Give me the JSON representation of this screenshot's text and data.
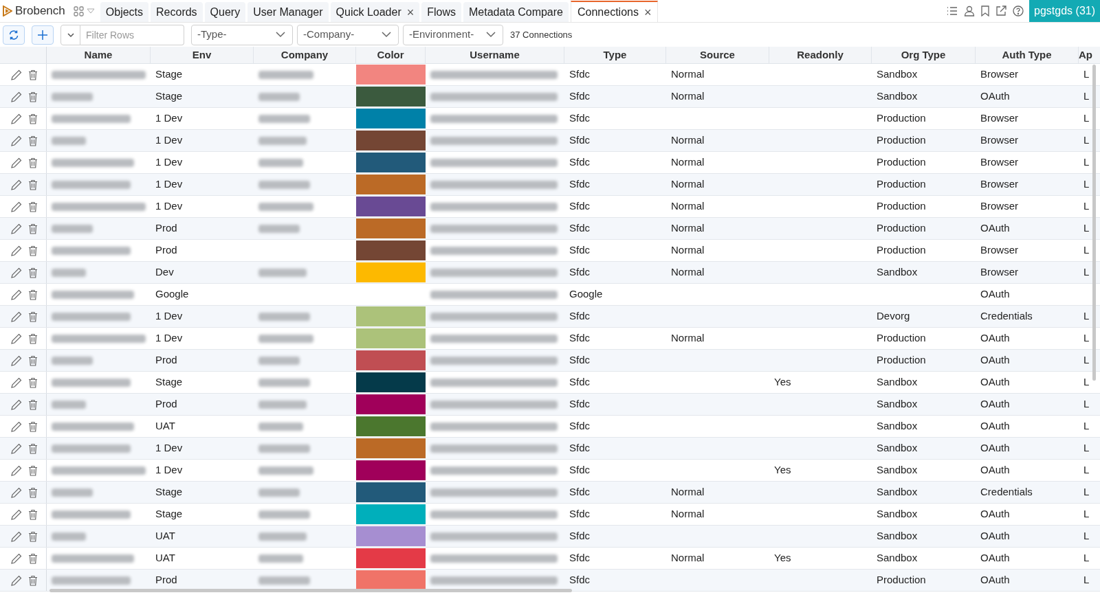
{
  "app": {
    "name": "Brobench"
  },
  "tabs": [
    {
      "label": "Objects",
      "selected": false,
      "closable": false
    },
    {
      "label": "Records",
      "selected": false,
      "closable": false
    },
    {
      "label": "Query",
      "selected": false,
      "closable": false
    },
    {
      "label": "User Manager",
      "selected": false,
      "closable": false
    },
    {
      "label": "Quick Loader",
      "selected": false,
      "closable": true
    },
    {
      "label": "Flows",
      "selected": false,
      "closable": false
    },
    {
      "label": "Metadata Compare",
      "selected": false,
      "closable": false
    },
    {
      "label": "Connections",
      "selected": true,
      "closable": true
    }
  ],
  "close_glyph": "×",
  "org_badge": "pgstgds (31)",
  "toolbar": {
    "filter": {
      "placeholder": "Filter Rows"
    },
    "dropdowns": [
      "-Type-",
      "-Company-",
      "-Environment-"
    ],
    "count": "37 Connections"
  },
  "table": {
    "columns": [
      "Name",
      "Env",
      "Company",
      "Color",
      "Username",
      "Type",
      "Source",
      "Readonly",
      "Org Type",
      "Auth Type",
      "Ap"
    ],
    "rows": [
      {
        "env": "Stage",
        "company_blurred": true,
        "color": "#f28580",
        "type": "Sfdc",
        "source": "Normal",
        "readonly": "",
        "org_type": "Sandbox",
        "auth_type": "Browser",
        "column_11": "L"
      },
      {
        "env": "Stage",
        "company_blurred": true,
        "color": "#3b5a3e",
        "type": "Sfdc",
        "source": "Normal",
        "readonly": "",
        "org_type": "Sandbox",
        "auth_type": "OAuth",
        "column_11": "L"
      },
      {
        "env": "1 Dev",
        "company_blurred": true,
        "color": "#0081a8",
        "type": "Sfdc",
        "source": "",
        "readonly": "",
        "org_type": "Production",
        "auth_type": "Browser",
        "column_11": "L"
      },
      {
        "env": "1 Dev",
        "company_blurred": true,
        "color": "#744634",
        "type": "Sfdc",
        "source": "Normal",
        "readonly": "",
        "org_type": "Production",
        "auth_type": "Browser",
        "column_11": "L"
      },
      {
        "env": "1 Dev",
        "company_blurred": true,
        "color": "#225a7a",
        "type": "Sfdc",
        "source": "Normal",
        "readonly": "",
        "org_type": "Production",
        "auth_type": "Browser",
        "column_11": "L"
      },
      {
        "env": "1 Dev",
        "company_blurred": true,
        "color": "#bb6a26",
        "type": "Sfdc",
        "source": "Normal",
        "readonly": "",
        "org_type": "Production",
        "auth_type": "Browser",
        "column_11": "L"
      },
      {
        "env": "1 Dev",
        "company_blurred": true,
        "color": "#694a94",
        "type": "Sfdc",
        "source": "Normal",
        "readonly": "",
        "org_type": "Production",
        "auth_type": "Browser",
        "column_11": "L"
      },
      {
        "env": "Prod",
        "company_blurred": true,
        "color": "#bb6a26",
        "type": "Sfdc",
        "source": "Normal",
        "readonly": "",
        "org_type": "Production",
        "auth_type": "OAuth",
        "column_11": "L"
      },
      {
        "env": "Prod",
        "company_blurred": false,
        "color": "#744634",
        "type": "Sfdc",
        "source": "Normal",
        "readonly": "",
        "org_type": "Production",
        "auth_type": "Browser",
        "column_11": "L"
      },
      {
        "env": "Dev",
        "company_blurred": true,
        "color": "#fdb900",
        "type": "Sfdc",
        "source": "Normal",
        "readonly": "",
        "org_type": "Sandbox",
        "auth_type": "Browser",
        "column_11": "L"
      },
      {
        "env": "Google",
        "company_blurred": false,
        "type": "Google",
        "source": "",
        "readonly": "",
        "org_type": "",
        "auth_type": "OAuth",
        "column_11": ""
      },
      {
        "env": "1 Dev",
        "company_blurred": true,
        "color": "#acc27a",
        "type": "Sfdc",
        "source": "",
        "readonly": "",
        "org_type": "Devorg",
        "auth_type": "Credentials",
        "column_11": "L"
      },
      {
        "env": "1 Dev",
        "company_blurred": true,
        "color": "#acc27a",
        "type": "Sfdc",
        "source": "Normal",
        "readonly": "",
        "org_type": "Production",
        "auth_type": "OAuth",
        "column_11": "L"
      },
      {
        "env": "Prod",
        "company_blurred": true,
        "color": "#c04e53",
        "type": "Sfdc",
        "source": "",
        "readonly": "",
        "org_type": "Production",
        "auth_type": "OAuth",
        "column_11": "L"
      },
      {
        "env": "Stage",
        "company_blurred": true,
        "color": "#053a4a",
        "type": "Sfdc",
        "source": "",
        "readonly": "Yes",
        "org_type": "Sandbox",
        "auth_type": "OAuth",
        "column_11": "L"
      },
      {
        "env": "Prod",
        "company_blurred": true,
        "color": "#a0005a",
        "type": "Sfdc",
        "source": "",
        "readonly": "",
        "org_type": "Sandbox",
        "auth_type": "OAuth",
        "column_11": "L"
      },
      {
        "env": "UAT",
        "company_blurred": true,
        "color": "#4b772e",
        "type": "Sfdc",
        "source": "",
        "readonly": "",
        "org_type": "Sandbox",
        "auth_type": "OAuth",
        "column_11": "L"
      },
      {
        "env": "1 Dev",
        "company_blurred": true,
        "color": "#bb6a26",
        "type": "Sfdc",
        "source": "",
        "readonly": "",
        "org_type": "Sandbox",
        "auth_type": "OAuth",
        "column_11": "L"
      },
      {
        "env": "1 Dev",
        "company_blurred": true,
        "color": "#a0005a",
        "type": "Sfdc",
        "source": "",
        "readonly": "Yes",
        "org_type": "Sandbox",
        "auth_type": "OAuth",
        "column_11": "L"
      },
      {
        "env": "Stage",
        "company_blurred": true,
        "color": "#225a7a",
        "type": "Sfdc",
        "source": "Normal",
        "readonly": "",
        "org_type": "Sandbox",
        "auth_type": "Credentials",
        "column_11": "L"
      },
      {
        "env": "Stage",
        "company_blurred": true,
        "color": "#00afbb",
        "type": "Sfdc",
        "source": "Normal",
        "readonly": "",
        "org_type": "Sandbox",
        "auth_type": "OAuth",
        "column_11": "L"
      },
      {
        "env": "UAT",
        "company_blurred": true,
        "color": "#a68ed1",
        "type": "Sfdc",
        "source": "",
        "readonly": "",
        "org_type": "Sandbox",
        "auth_type": "OAuth",
        "column_11": "L"
      },
      {
        "env": "UAT",
        "company_blurred": true,
        "color": "#e43a47",
        "type": "Sfdc",
        "source": "Normal",
        "readonly": "Yes",
        "org_type": "Sandbox",
        "auth_type": "OAuth",
        "column_11": "L"
      },
      {
        "env": "Prod",
        "company_blurred": true,
        "color": "#f07368",
        "type": "Sfdc",
        "source": "",
        "readonly": "",
        "org_type": "Production",
        "auth_type": "OAuth",
        "column_11": "L"
      }
    ]
  }
}
